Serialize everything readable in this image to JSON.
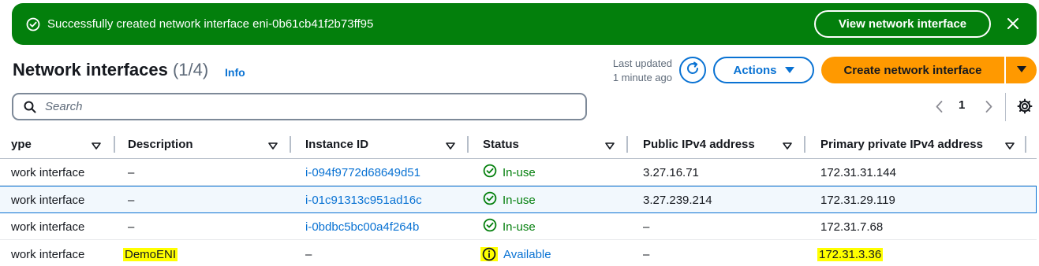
{
  "flash": {
    "message": "Successfully created network interface eni-0b61cb41f2b73ff95",
    "button_label": "View network interface",
    "icon": "check-circle-icon",
    "close_icon": "close-icon",
    "color": "#037f0c"
  },
  "header": {
    "title": "Network interfaces",
    "count": "(1/4)",
    "info": "Info",
    "last_updated_line1": "Last updated",
    "last_updated_line2": "1 minute ago",
    "actions_label": "Actions",
    "create_label": "Create network interface",
    "accent": "#0972d3",
    "primary": "#ff9900"
  },
  "search": {
    "placeholder": "Search",
    "value": ""
  },
  "pagination": {
    "current_page": "1"
  },
  "table": {
    "columns": [
      {
        "label": "ype"
      },
      {
        "label": "Description"
      },
      {
        "label": "Instance ID"
      },
      {
        "label": "Status"
      },
      {
        "label": "Public IPv4 address"
      },
      {
        "label": "Primary private IPv4 address"
      }
    ],
    "rows": [
      {
        "type": "work interface",
        "description": "–",
        "instance_id": "i-094f9772d68649d51",
        "status": "In-use",
        "status_kind": "ok",
        "public_ip": "3.27.16.71",
        "private_ip": "172.31.31.144"
      },
      {
        "type": "work interface",
        "description": "–",
        "instance_id": "i-01c91313c951ad16c",
        "status": "In-use",
        "status_kind": "ok",
        "public_ip": "3.27.239.214",
        "private_ip": "172.31.29.119"
      },
      {
        "type": "work interface",
        "description": "–",
        "instance_id": "i-0bdbc5bc00a4f264b",
        "status": "In-use",
        "status_kind": "ok",
        "public_ip": "–",
        "private_ip": "172.31.7.68"
      },
      {
        "type": "work interface",
        "description": "DemoENI",
        "instance_id": "–",
        "status": "Available",
        "status_kind": "info",
        "public_ip": "–",
        "private_ip": "172.31.3.36"
      }
    ],
    "selected_row": 1,
    "highlight_color": "#ffff00"
  }
}
